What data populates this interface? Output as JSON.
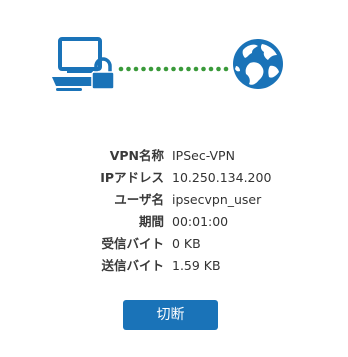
{
  "connection_graphic": {
    "left_icon": "computer-with-lock-icon",
    "link": "dotted-connection-line",
    "right_icon": "globe-icon",
    "colors": {
      "icon_blue": "#1a73b8",
      "link_green": "#3a9a3a"
    }
  },
  "vpn_info": {
    "rows": [
      {
        "label": "VPN名称",
        "value": "IPSec-VPN"
      },
      {
        "label": "IPアドレス",
        "value": "10.250.134.200"
      },
      {
        "label": "ユーザ名",
        "value": "ipsecvpn_user"
      },
      {
        "label": "期間",
        "value": "00:01:00"
      },
      {
        "label": "受信バイト",
        "value": "0 KB"
      },
      {
        "label": "送信バイト",
        "value": "1.59 KB"
      }
    ]
  },
  "actions": {
    "disconnect_label": "切断",
    "button_color": "#1a73b8"
  }
}
